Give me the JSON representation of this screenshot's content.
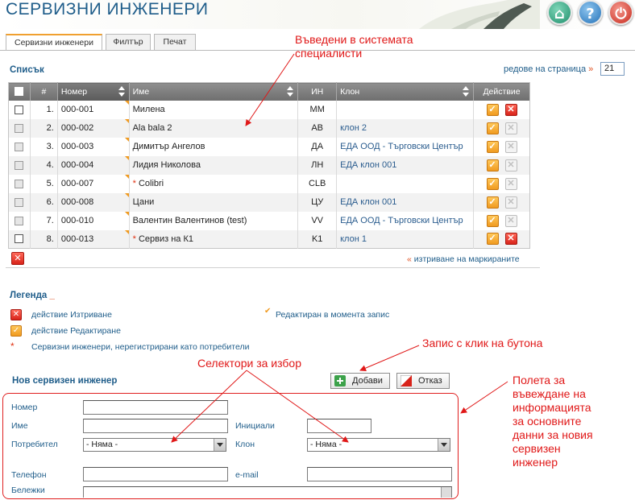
{
  "header": {
    "title": "СЕРВИЗНИ ИНЖЕНЕРИ",
    "buttons": [
      "home-icon",
      "help-icon",
      "power-icon"
    ]
  },
  "tabs": [
    {
      "label": "Сервизни инженери",
      "active": true
    },
    {
      "label": "Филтър",
      "active": false
    },
    {
      "label": "Печат",
      "active": false
    }
  ],
  "list": {
    "title": "Списък",
    "rows_per_page_label": "редове на страница",
    "rows_per_page_arrow": "»",
    "rows_per_page_value": "21",
    "columns": [
      "#",
      "Номер",
      "Име",
      "ИН",
      "Клон",
      "Действие"
    ],
    "rows": [
      {
        "n": "1.",
        "number": "000-001",
        "star": "",
        "name": "Милена",
        "initials": "ММ",
        "branch": "",
        "can_delete": true
      },
      {
        "n": "2.",
        "number": "000-002",
        "star": "",
        "name": "Ala bala 2",
        "initials": "AB",
        "branch": "клон 2",
        "can_delete": false
      },
      {
        "n": "3.",
        "number": "000-003",
        "star": "",
        "name": "Димитър Ангелов",
        "initials": "ДА",
        "branch": "ЕДА ООД - Търговски Център",
        "can_delete": false
      },
      {
        "n": "4.",
        "number": "000-004",
        "star": "",
        "name": "Лидия Николова",
        "initials": "ЛН",
        "branch": "ЕДА клон 001",
        "can_delete": false
      },
      {
        "n": "5.",
        "number": "000-007",
        "star": "*",
        "name": "Colibri",
        "initials": "CLB",
        "branch": "",
        "can_delete": false
      },
      {
        "n": "6.",
        "number": "000-008",
        "star": "",
        "name": "Цани",
        "initials": "ЦУ",
        "branch": "ЕДА клон 001",
        "can_delete": false
      },
      {
        "n": "7.",
        "number": "000-010",
        "star": "",
        "name": "Валентин Валентинов (test)",
        "initials": "VV",
        "branch": "ЕДА ООД - Търговски Център",
        "can_delete": false
      },
      {
        "n": "8.",
        "number": "000-013",
        "star": "*",
        "name": "Сервиз на К1",
        "initials": "K1",
        "branch": "клон 1",
        "can_delete": true
      }
    ],
    "bulk_delete_arrow": "«",
    "bulk_delete_label": "изтриване на маркираните"
  },
  "legend": {
    "title": "Легенда",
    "title_suffix": "_",
    "delete": "действие Изтриване",
    "edit": "действие Редактиране",
    "edited_mark": "✔",
    "edited": "Редактиран в момента запис",
    "star_mark": "*",
    "unregistered": "Сервизни инженери, нерегистрирани като потребители"
  },
  "form": {
    "title": "Нов сервизен инженер",
    "add_label": "Добави",
    "cancel_label": "Отказ",
    "number_label": "Номер",
    "name_label": "Име",
    "initials_label": "Инициали",
    "user_label": "Потребител",
    "branch_label": "Клон",
    "user_value": "- Няма -",
    "branch_value": "- Няма -",
    "phone_label": "Телефон",
    "email_label": "e-mail",
    "notes_label": "Бележки"
  },
  "annotations": {
    "entered": "Въведени в системата\nспециалисти",
    "save": "Запис с клик на бутона",
    "selectors": "Селектори за избор",
    "fields": "Полета за\nвъвеждане на\nинформацията\nза основните\nданни за новия\nсервизен\nинженер"
  },
  "colors": {
    "title": "#1f5d8a",
    "annotation": "#e01818",
    "accent": "#f09a20",
    "delete": "#d8231a"
  }
}
